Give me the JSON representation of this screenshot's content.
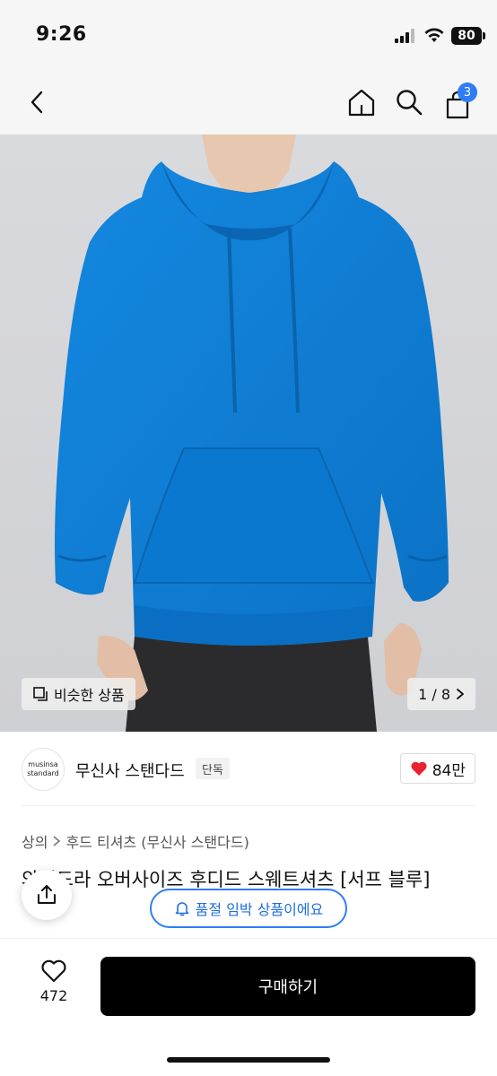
{
  "status": {
    "time": "9:26",
    "battery": "80"
  },
  "nav": {
    "cart_count": "3",
    "icons": [
      "back-icon",
      "home-icon",
      "search-icon",
      "cart-icon"
    ]
  },
  "image": {
    "similar_label": "비슷한 상품",
    "page_counter": "1 / 8",
    "colors": {
      "background": "#d6d7da",
      "hoodie": "#0b7fd6"
    }
  },
  "brand": {
    "logo_line1": "musinsa",
    "logo_line2": "standard",
    "name": "무신사 스탠다드",
    "tag": "단독",
    "likes": "84만"
  },
  "breadcrumb": {
    "category": "상의",
    "subcategory": "후드 티셔츠 (무신사 스탠다드)"
  },
  "product": {
    "title": "와이드라 오버사이즈 후디드 스웨트셔츠 [서프 블루]"
  },
  "notice": {
    "soldout_label": "품절 임박 상품이에요"
  },
  "bottom": {
    "wish_count": "472",
    "buy_label": "구매하기"
  },
  "accent": "#2f7df6"
}
